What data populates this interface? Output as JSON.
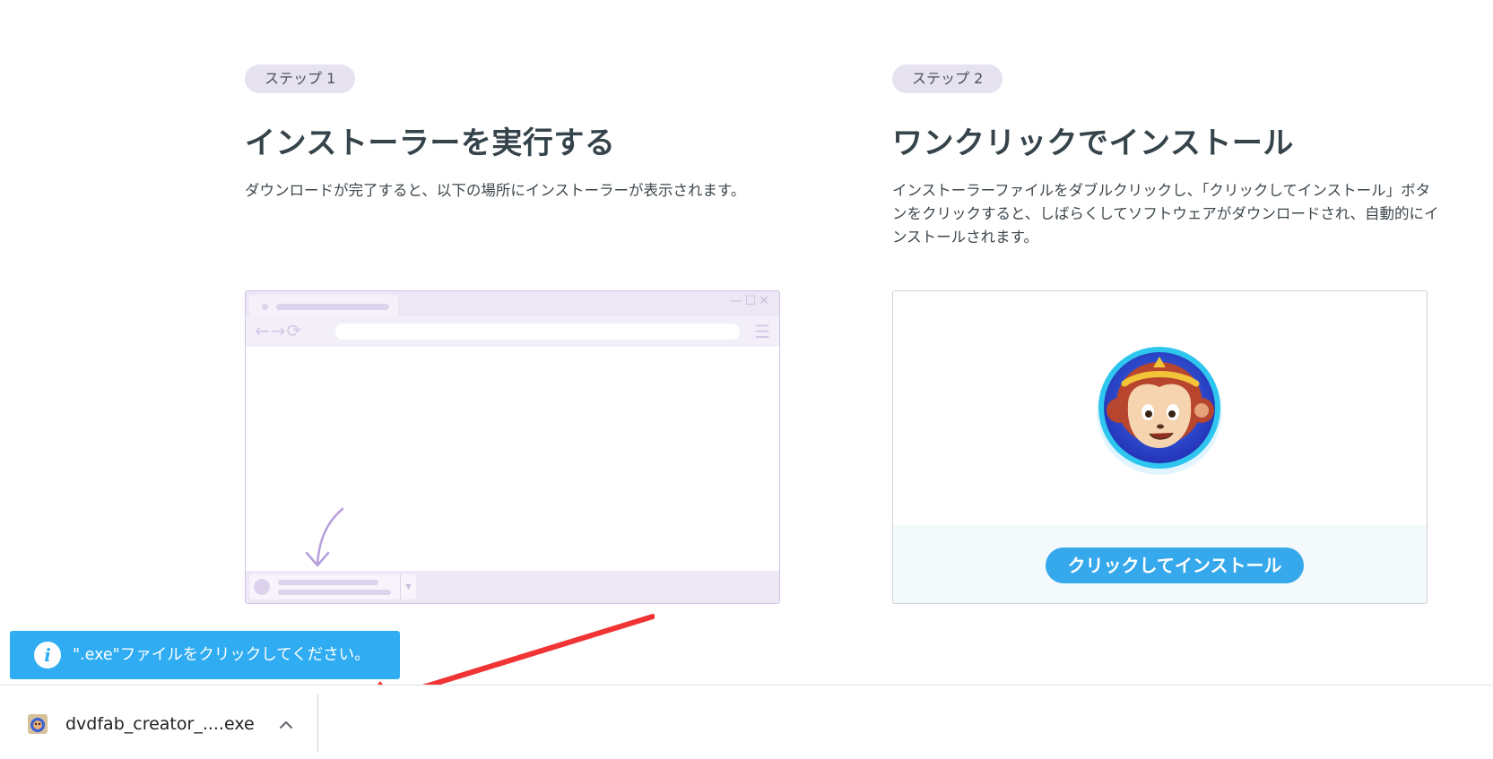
{
  "step1": {
    "badge": "ステップ 1",
    "title": "インストーラーを実行する",
    "description": "ダウンロードが完了すると、以下の場所にインストーラーが表示されます。"
  },
  "step2": {
    "badge": "ステップ 2",
    "title": "ワンクリックでインストール",
    "description": "インストーラーファイルをダブルクリックし、「クリックしてインストール」ボタンをクリックすると、しばらくしてソフトウェアがダウンロードされ、自動的にインストールされます。",
    "install_button": "クリックしてインストール"
  },
  "hint": {
    "icon": "i",
    "text": "\".exe\"ファイルをクリックしてください。"
  },
  "download_bar": {
    "filename": "dvdfab_creator_....exe"
  },
  "icons": {
    "info": "info-icon",
    "file": "dvdfab-file-icon",
    "chevron": "chevron-up-icon",
    "arrow": "red-arrow-icon",
    "logo": "dvdfab-monkey-logo"
  },
  "colors": {
    "accent_blue": "#30acf2",
    "install_button": "#35a9ec",
    "badge_bg": "#e6e2ef",
    "arrow_red": "#f03333",
    "mock_purple": "#cfc3e6"
  }
}
